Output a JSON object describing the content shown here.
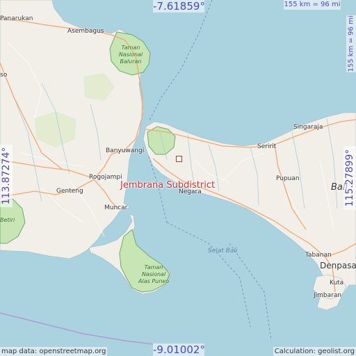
{
  "map": {
    "target_name": "Jembrana Subdistrict",
    "marker_color": "#c83232",
    "water_color": "#aad3df",
    "land_color": "#f2efe9",
    "park_color": "#c8e6b4"
  },
  "coordinates": {
    "top": "-7.61859°",
    "bottom": "-9.01002°",
    "left": "113.87274°",
    "right": "115.27899°"
  },
  "scale": {
    "top": "155 km = 96 mi",
    "right": "155 km = 96 mi"
  },
  "places": {
    "panarukan": "Panarukan",
    "asembagus": "Asembagus",
    "so": "so",
    "banyuwangi": "Banyuwangi",
    "rogojampi": "Rogojampi",
    "genteng": "Genteng",
    "muncar": "Muncar",
    "negara": "Negara",
    "singaraja": "Singaraja",
    "seririt": "Seririt",
    "pupuan": "Pupuan",
    "bali": "Bali",
    "tabanan": "Tabanan",
    "denpasar": "Denpasar",
    "kuta": "Kuta",
    "jimbaran": "Jimbaran",
    "betiri": "Betiri"
  },
  "parks": {
    "baluran": [
      "Taman",
      "Nasional",
      "Baluran"
    ],
    "alas_purwo": [
      "Taman",
      "Nasional",
      "Alas Purwo"
    ]
  },
  "sea": {
    "selat_bali": "Selat Bali"
  },
  "footer": {
    "left": "map data: openstreetmap.org",
    "right": "Calculation: geolist.org"
  }
}
